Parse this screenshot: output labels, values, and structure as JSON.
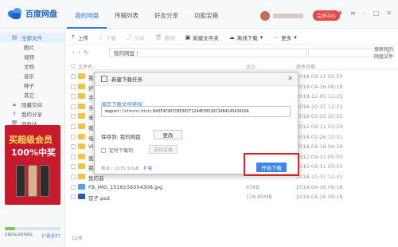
{
  "app": {
    "name": "百度网盘"
  },
  "nav": {
    "tabs": [
      {
        "label": "我的网盘"
      },
      {
        "label": "传输列表"
      },
      {
        "label": "好友分享"
      },
      {
        "label": "功能宝箱"
      }
    ]
  },
  "user": {
    "vip_label": "会员中心"
  },
  "sidebar": {
    "items": [
      {
        "label": "全部文件"
      },
      {
        "label": "图片"
      },
      {
        "label": "视频"
      },
      {
        "label": "文档"
      },
      {
        "label": "音乐"
      },
      {
        "label": "种子"
      },
      {
        "label": "其它"
      },
      {
        "label": "隐藏空间"
      },
      {
        "label": "我的分享"
      },
      {
        "label": "回收站"
      }
    ],
    "promo": {
      "line1": "买超级会员",
      "line2": "100%中奖"
    },
    "storage": {
      "used_text": "380G/2056G",
      "expand_label": "扩容至5T",
      "used_fraction": 0.18
    }
  },
  "toolbar": {
    "upload": "上传",
    "download": "下载",
    "share": "分享",
    "delete": "删除",
    "new_folder": "新建文件夹",
    "offline_download": "离线下载",
    "more": "更多"
  },
  "path": {
    "current": "我的网盘",
    "search_placeholder": "搜索我的网盘文件"
  },
  "list": {
    "header_name": "文件名",
    "header_size": "大小",
    "header_date": "修改日期",
    "rows": [
      {
        "name": "我的应",
        "size": "-",
        "date": "2018-09-11 05:50",
        "type": "folder"
      },
      {
        "name": "炉逃杂",
        "size": "-",
        "date": "2018-04-16 06:18",
        "type": "folder"
      },
      {
        "name": "手续量",
        "size": "-",
        "date": "2018-12-05 12:25",
        "type": "folder"
      },
      {
        "name": "手事闻",
        "size": "-",
        "date": "2018-10-31 12:31",
        "type": "folder"
      },
      {
        "name": "来自:",
        "size": "-",
        "date": "2018-02-25 20:25",
        "type": "folder"
      },
      {
        "name": "我的人",
        "size": "-",
        "date": "2012-09-11 05:50",
        "type": "folder"
      },
      {
        "name": "电脑电",
        "size": "-",
        "date": "2018-02-26 12:51",
        "type": "folder"
      },
      {
        "name": "VIP",
        "size": "-",
        "date": "2018-04-16 06:18",
        "type": "folder"
      },
      {
        "name": "我的图",
        "size": "-",
        "date": "2012-09-11 05:50",
        "type": "folder"
      },
      {
        "name": "我的文",
        "size": "-",
        "date": "2012-09-11 05:50",
        "type": "folder"
      },
      {
        "name": "我的音",
        "size": "-",
        "date": "2018-10-31 12:31",
        "type": "folder"
      },
      {
        "name": "FB_IMG_1516156354308.jpg",
        "size": "87KB",
        "date": "2018-04-16 06:18",
        "type": "img"
      },
      {
        "name": "饺子.psd",
        "size": "116.85MB",
        "date": "2018-04-16 06:18",
        "type": "psd"
      }
    ],
    "count_text": "12项"
  },
  "modal": {
    "title": "新建下载任务",
    "label": "填写下载文件链接",
    "link_value": "magnet:?xt=urn:btih:B43F4C907CBE30CF1244E3052DC34B4245A36C6A",
    "save_to": "保存到: 我的网盘",
    "change": "更改",
    "timer": "定时下载到",
    "choose_device": "选择设备",
    "free_space": "剩余：1675.32GB",
    "expand": "扩容",
    "start": "开始下载"
  },
  "colors": {
    "accent": "#2e7ae6",
    "highlight": "#e02020",
    "promo": "#c9192d"
  }
}
